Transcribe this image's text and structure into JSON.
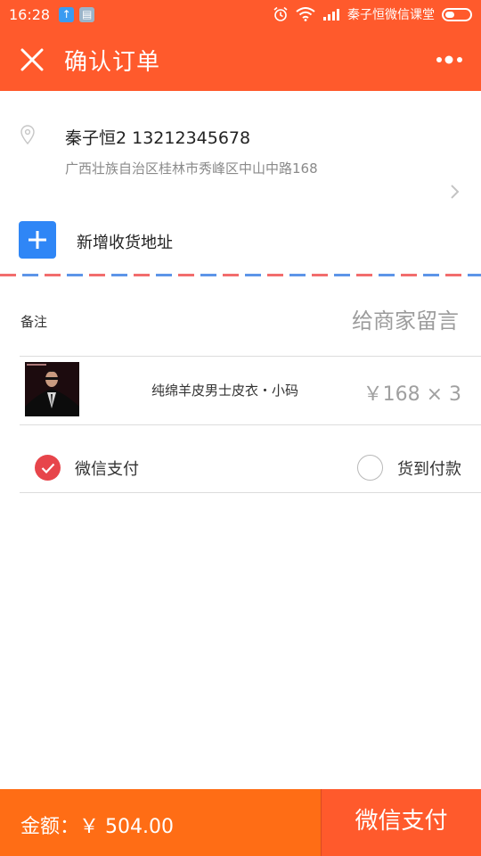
{
  "status_bar": {
    "time": "16:28",
    "carrier": "秦子恒微信课堂"
  },
  "header": {
    "title": "确认订单"
  },
  "address": {
    "name_phone": "秦子恒2 13212345678",
    "detail": "广西壮族自治区桂林市秀峰区中山中路168"
  },
  "add_address": {
    "label": "新增收货地址"
  },
  "remark": {
    "label": "备注",
    "placeholder": "给商家留言"
  },
  "product": {
    "name": "纯绵羊皮男士皮衣・小码",
    "price": "￥168 × 3"
  },
  "payment": {
    "wechat_label": "微信支付",
    "cod_label": "货到付款",
    "selected": "wechat"
  },
  "footer": {
    "amount": "金额：￥ 504.00",
    "pay_button": "微信支付"
  },
  "colors": {
    "primary": "#ff5a2c",
    "bottom_bar": "#ff6d15",
    "checked": "#e7454b",
    "add_button": "#2f86f6"
  }
}
